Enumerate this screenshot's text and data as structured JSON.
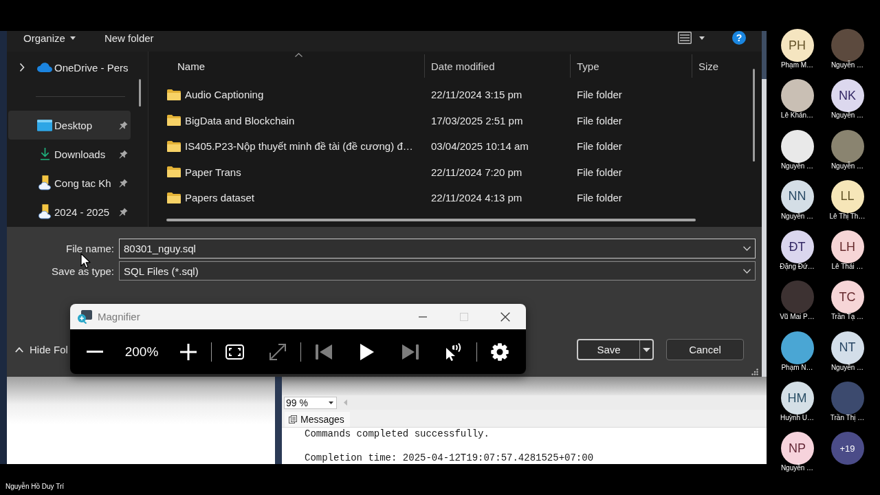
{
  "meeting": {
    "presenter": "Nguyễn Hồ Duy Trí"
  },
  "dialog": {
    "toolbar": {
      "organize": "Organize",
      "new_folder": "New folder",
      "help": "?"
    },
    "locations": [
      {
        "kind": "onedrive",
        "label": "OneDrive - Pers",
        "expanded": false,
        "selected": false
      }
    ],
    "quick_access": [
      {
        "kind": "desktop",
        "label": "Desktop",
        "pinned": true,
        "selected": true
      },
      {
        "kind": "downloads",
        "label": "Downloads",
        "pinned": true,
        "selected": false
      },
      {
        "kind": "cloud-folder",
        "label": "Cong tac Kh",
        "pinned": true,
        "selected": false
      },
      {
        "kind": "cloud-folder",
        "label": "2024 - 2025",
        "pinned": true,
        "selected": false
      }
    ],
    "columns": [
      {
        "label": "Name",
        "sorted": true
      },
      {
        "label": "Date modified",
        "sorted": false
      },
      {
        "label": "Type",
        "sorted": false
      },
      {
        "label": "Size",
        "sorted": false
      }
    ],
    "rows": [
      {
        "name": "Audio Captioning",
        "date": "22/11/2024 3:15 pm",
        "type": "File folder",
        "selected": false
      },
      {
        "name": "BigData and Blockchain",
        "date": "17/03/2025 2:51 pm",
        "type": "File folder",
        "selected": false
      },
      {
        "name": "IS405.P23-Nộp thuyết minh đề tài (đề cương) đ…",
        "date": "03/04/2025 10:14 am",
        "type": "File folder",
        "selected": false
      },
      {
        "name": "Paper Trans",
        "date": "22/11/2024 7:20 pm",
        "type": "File folder",
        "selected": false
      },
      {
        "name": "Papers dataset",
        "date": "22/11/2024 4:13 pm",
        "type": "File folder",
        "selected": false
      }
    ],
    "fields": [
      {
        "label": "File name:",
        "value": "80301_nguy.sql",
        "focused": true
      },
      {
        "label": "Save as type:",
        "value": "SQL Files (*.sql)",
        "focused": false
      }
    ],
    "hide_folders": {
      "label": "Hide Fol"
    },
    "buttons": [
      {
        "label": "Save",
        "kind": "split",
        "default": true
      },
      {
        "label": "Cancel",
        "kind": "plain",
        "default": false
      }
    ]
  },
  "magnifier": {
    "title": "Magnifier",
    "window_controls": [
      {
        "kind": "minimize",
        "disabled": false
      },
      {
        "kind": "maximize",
        "disabled": true
      },
      {
        "kind": "close",
        "disabled": false
      }
    ],
    "groups": [
      {
        "items": [
          {
            "kind": "zoom-out",
            "disabled": false
          },
          {
            "kind": "level",
            "text": "200%"
          },
          {
            "kind": "zoom-in",
            "disabled": false
          }
        ]
      },
      {
        "items": [
          {
            "kind": "full-screen",
            "disabled": false
          },
          {
            "kind": "resize",
            "disabled": true
          }
        ]
      },
      {
        "items": [
          {
            "kind": "previous",
            "disabled": true
          },
          {
            "kind": "play",
            "disabled": false
          },
          {
            "kind": "next",
            "disabled": true
          },
          {
            "kind": "read-from-pointer",
            "disabled": false
          }
        ]
      },
      {
        "items": [
          {
            "kind": "settings",
            "disabled": false
          }
        ]
      }
    ]
  },
  "query_window": {
    "zoom": "99 %",
    "tab": "Messages",
    "messages": [
      "Commands completed successfully.",
      "Completion time: 2025-04-12T19:07:57.4281525+07:00"
    ]
  },
  "participants": [
    {
      "kind": "initials",
      "initials": "PH",
      "name": "Phạm M…",
      "color": "#f5e5c0"
    },
    {
      "kind": "photo",
      "name": "Lê Khán…",
      "color": "#c9bfb4"
    },
    {
      "kind": "photo",
      "name": "Nguyễn …",
      "color": "#e9e9e9"
    },
    {
      "kind": "initials",
      "initials": "NN",
      "name": "Nguyễn …",
      "color": "#d4dee6"
    },
    {
      "kind": "initials",
      "initials": "ĐT",
      "name": "Đặng Đứ…",
      "color": "#dad6ee"
    },
    {
      "kind": "photo",
      "name": "Vũ Mai P…",
      "color": "#3d3232"
    },
    {
      "kind": "photo",
      "name": "Phạm N…",
      "color": "#4aa6d4"
    },
    {
      "kind": "initials",
      "initials": "HM",
      "name": "Huỳnh U…",
      "color": "#d4dfe6"
    },
    {
      "kind": "initials",
      "initials": "NP",
      "name": "Nguyễn …",
      "color": "#f6d3dc"
    },
    {
      "kind": "photo",
      "name": "Nguyễn …",
      "color": "#5c4a3e"
    },
    {
      "kind": "initials",
      "initials": "NK",
      "name": "Nguyễn …",
      "color": "#dcd8ee"
    },
    {
      "kind": "photo",
      "name": "Nguyễn …",
      "color": "#8a8470"
    },
    {
      "kind": "initials",
      "initials": "LL",
      "name": "Lê Thị Th…",
      "color": "#f6e6b8"
    },
    {
      "kind": "initials",
      "initials": "LH",
      "name": "Lê Thái …",
      "color": "#f6d5d6"
    },
    {
      "kind": "initials",
      "initials": "TC",
      "name": "Trần Tạ …",
      "color": "#f6d5d7"
    },
    {
      "kind": "initials",
      "initials": "NT",
      "name": "Nguyễn …",
      "color": "#d3dee9"
    },
    {
      "kind": "photo",
      "name": "Trần Thị …",
      "color": "#3c4a6e"
    },
    {
      "kind": "more",
      "label": "+19",
      "color": "#4b4c88"
    }
  ]
}
